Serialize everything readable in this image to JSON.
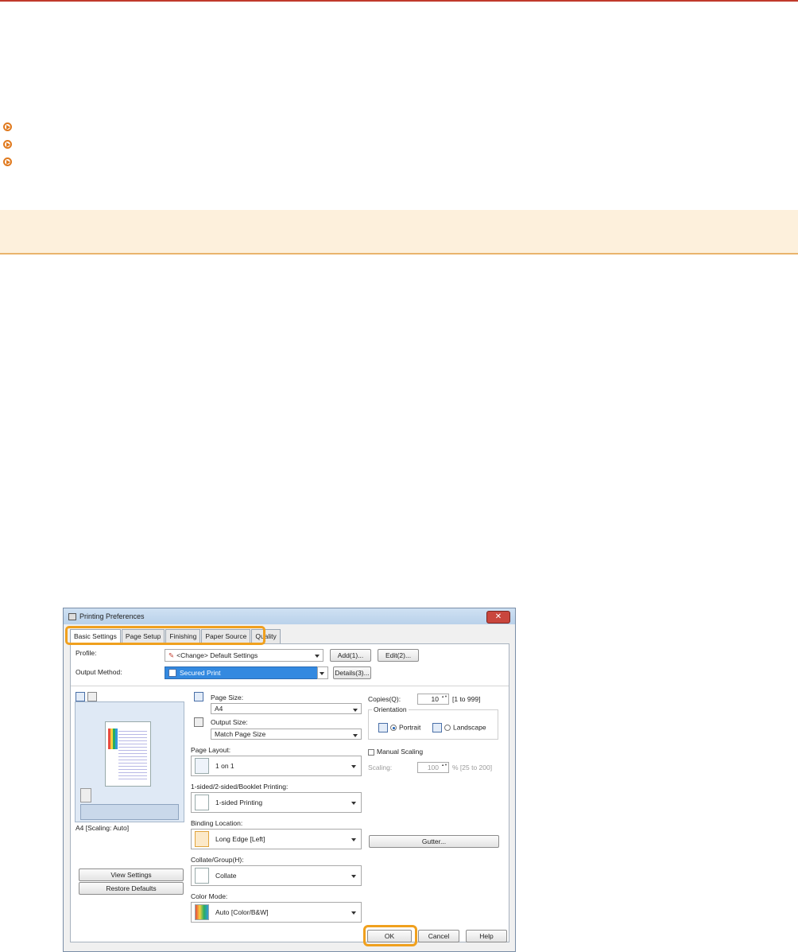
{
  "dialog": {
    "title": "Printing Preferences",
    "close_label": "✕",
    "tabs": [
      "Basic Settings",
      "Page Setup",
      "Finishing",
      "Paper Source",
      "Quality"
    ],
    "profile": {
      "label": "Profile:",
      "value": "<Change> Default Settings",
      "add": "Add(1)...",
      "edit": "Edit(2)..."
    },
    "output_method": {
      "label": "Output Method:",
      "value": "Secured Print",
      "details": "Details(3)..."
    },
    "preview": {
      "caption": "A4 [Scaling: Auto]"
    },
    "buttons": {
      "view_settings": "View Settings",
      "restore_defaults": "Restore Defaults",
      "gutter": "Gutter...",
      "ok": "OK",
      "cancel": "Cancel",
      "help": "Help"
    },
    "page_size": {
      "label": "Page Size:",
      "value": "A4"
    },
    "output_size": {
      "label": "Output Size:",
      "value": "Match Page Size"
    },
    "page_layout": {
      "label": "Page Layout:",
      "value": "1 on 1"
    },
    "sided": {
      "label": "1-sided/2-sided/Booklet Printing:",
      "value": "1-sided Printing"
    },
    "binding": {
      "label": "Binding Location:",
      "value": "Long Edge [Left]"
    },
    "collate": {
      "label": "Collate/Group(H):",
      "value": "Collate"
    },
    "color_mode": {
      "label": "Color Mode:",
      "value": "Auto [Color/B&W]"
    },
    "copies": {
      "label": "Copies(Q):",
      "value": "10",
      "range": "[1 to 999]"
    },
    "orientation": {
      "label": "Orientation",
      "portrait": "Portrait",
      "landscape": "Landscape"
    },
    "manual_scaling": {
      "label": "Manual Scaling"
    },
    "scaling": {
      "label": "Scaling:",
      "value": "100",
      "range": "% [25 to 200]"
    }
  }
}
